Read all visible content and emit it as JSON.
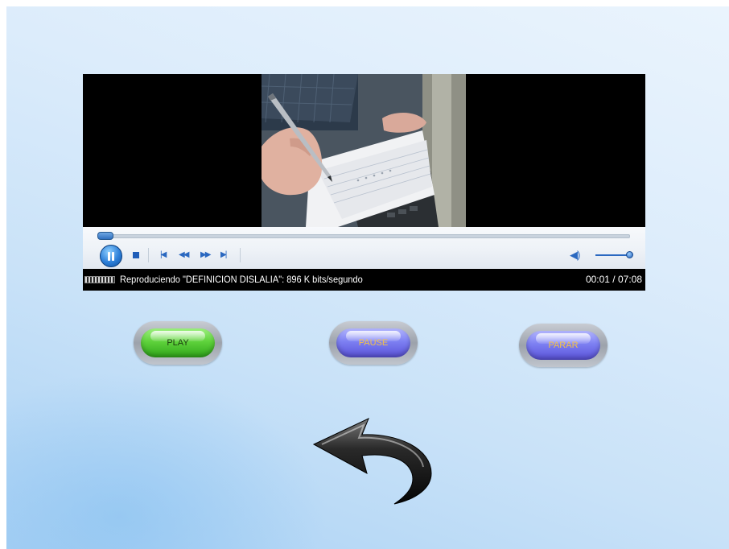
{
  "player": {
    "status_text": "Reproduciendo \"DEFINICION DISLALIA\": 896 K bits/segundo",
    "time": "00:01 / 07:08",
    "seek_progress": 0.01,
    "volume_level": 1.0,
    "controls": {
      "pause_icon": "pause-icon",
      "stop_icon": "stop-icon",
      "prev_icon": "previous-icon",
      "rewind_icon": "rewind-icon",
      "forward_icon": "fast-forward-icon",
      "next_icon": "next-icon",
      "volume_icon": "volume-icon"
    }
  },
  "buttons": {
    "play": "PLAY",
    "pause": "PAUSE",
    "stop": "PARAR"
  },
  "navigation": {
    "back_icon": "back-arrow-icon"
  },
  "colors": {
    "play": "#5fd23c",
    "pause_stop": "#7d80f2",
    "pause_stop_text": "#f3c24a",
    "player_accent": "#2a68c0"
  }
}
